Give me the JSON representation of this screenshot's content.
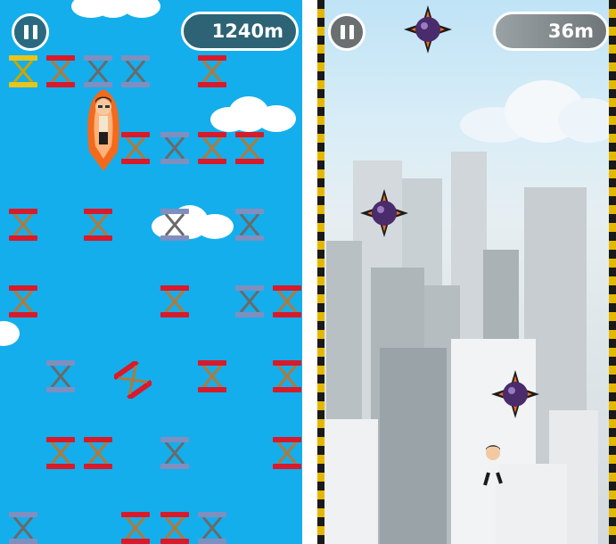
{
  "left_game": {
    "pause_button": {
      "icon": "pause-icon"
    },
    "distance": "1240m",
    "colors": {
      "sky": "#14aeec",
      "spring_red": "#d81a2a",
      "spring_silver": "#7f8fbf",
      "spring_gold": "#e6c51c",
      "rocket": "#f36a1d"
    },
    "player": {
      "state": "rocket-boost",
      "icon": "rocket-man-icon"
    }
  },
  "right_game": {
    "pause_button": {
      "icon": "pause-icon"
    },
    "distance": "36m",
    "player": {
      "state": "jumping",
      "icon": "man-icon"
    },
    "hazards": {
      "icon": "spiked-bomb-icon"
    },
    "colors": {
      "border_stripe": "#e4b800"
    }
  }
}
